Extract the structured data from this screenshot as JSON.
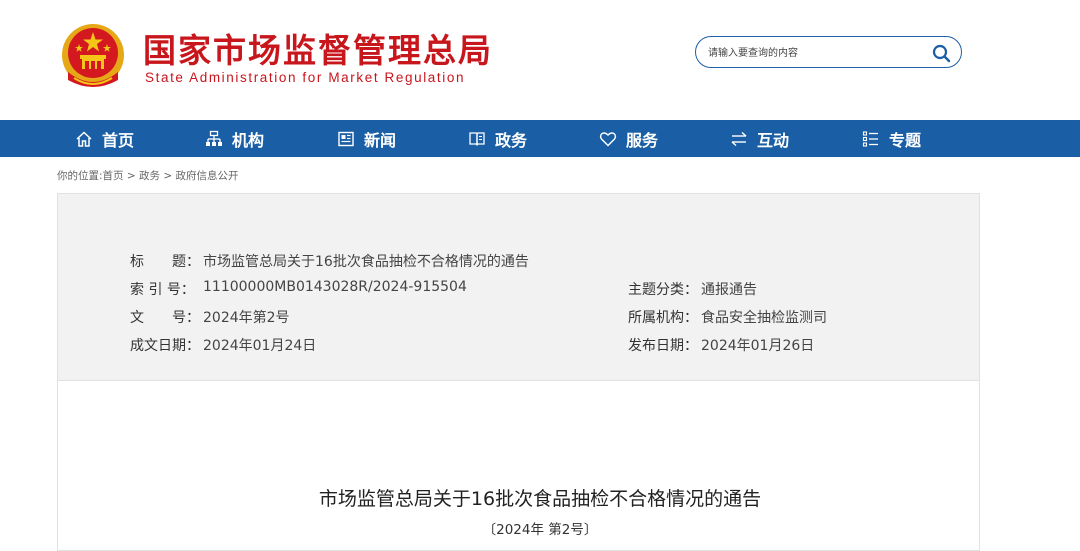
{
  "header": {
    "site_name_cn": "国家市场监督管理总局",
    "site_name_en": "State Administration for Market Regulation",
    "emblem_icon": "national-emblem-icon",
    "brand_color": "#c8161d"
  },
  "search": {
    "placeholder": "请输入要查询的内容",
    "icon": "search-icon"
  },
  "nav": {
    "color": "#1a5fa5",
    "items": [
      {
        "label": "首页",
        "icon": "home-icon"
      },
      {
        "label": "机构",
        "icon": "org-chart-icon"
      },
      {
        "label": "新闻",
        "icon": "newspaper-icon"
      },
      {
        "label": "政务",
        "icon": "book-icon"
      },
      {
        "label": "服务",
        "icon": "heart-icon"
      },
      {
        "label": "互动",
        "icon": "exchange-icon"
      },
      {
        "label": "专题",
        "icon": "list-icon"
      }
    ]
  },
  "breadcrumb": {
    "prefix": "你的位置:",
    "items": [
      "首页",
      "政务",
      "政府信息公开"
    ],
    "separator": " > "
  },
  "info": {
    "title_label": "标　　题：",
    "title_value": "市场监管总局关于16批次食品抽检不合格情况的通告",
    "index_label": "索 引 号：",
    "index_value": "11100000MB0143028R/2024-915504",
    "topic_label": "主题分类：",
    "topic_value": "通报通告",
    "docno_label": "文　　号：",
    "docno_value": "2024年第2号",
    "org_label": "所属机构：",
    "org_value": "食品安全抽检监测司",
    "written_label": "成文日期：",
    "written_value": "2024年01月24日",
    "published_label": "发布日期：",
    "published_value": "2024年01月26日"
  },
  "document": {
    "title": "市场监管总局关于16批次食品抽检不合格情况的通告",
    "number": "〔2024年 第2号〕"
  }
}
